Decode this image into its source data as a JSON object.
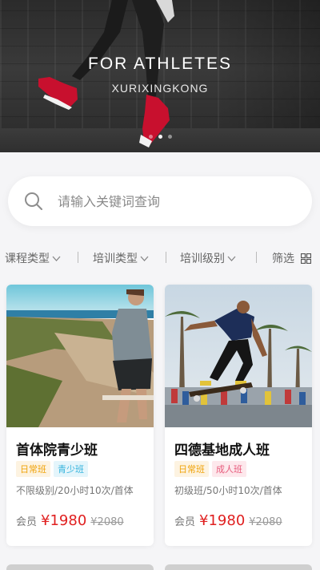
{
  "banner": {
    "title": "FOR ATHLETES",
    "subtitle": "XURIXINGKONG",
    "dots": 3,
    "active_dot": 1
  },
  "search": {
    "placeholder": "请输入关键词查询",
    "icon": "search-icon"
  },
  "filters": {
    "items": [
      {
        "label": "课程类型",
        "icon": "chevron-down-icon"
      },
      {
        "label": "培训类型",
        "icon": "chevron-down-icon"
      },
      {
        "label": "培训级别",
        "icon": "chevron-down-icon"
      }
    ],
    "screen_label": "筛选",
    "screen_icon": "grid-icon"
  },
  "courses": [
    {
      "title": "首体院青少班",
      "tags": [
        {
          "text": "日常班",
          "color": "#f0a30a"
        },
        {
          "text": "青少班",
          "color": "#35b4dd"
        }
      ],
      "desc": "不限级别/20小时10次/首体",
      "member_label": "会员",
      "price": "¥1980",
      "original_price": "¥2080"
    },
    {
      "title": "四德基地成人班",
      "tags": [
        {
          "text": "日常班",
          "color": "#f0a30a"
        },
        {
          "text": "成人班",
          "color": "#e75a7c"
        }
      ],
      "desc": "初级班/50小时10次/首体",
      "member_label": "会员",
      "price": "¥1980",
      "original_price": "¥2080"
    }
  ],
  "colors": {
    "price": "#e02020",
    "background": "#f5f5f7"
  }
}
